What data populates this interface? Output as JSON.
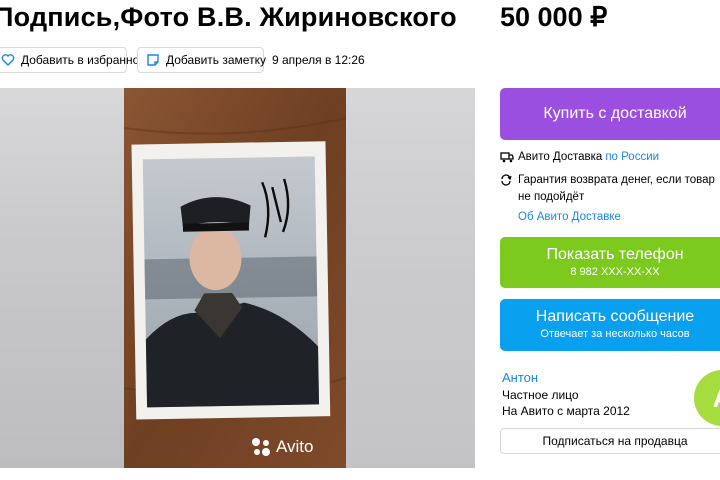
{
  "listing": {
    "title": "Подпись,Фото В.В. Жириновского",
    "price": "50 000 ₽",
    "favorite_label": "Добавить в избранное",
    "note_label": "Добавить заметку",
    "date": "9 апреля в 12:26"
  },
  "gallery": {
    "watermark": "Avito",
    "photo_alt": "Signed photograph on wooden table"
  },
  "purchase": {
    "buy_label": "Купить с доставкой",
    "delivery_prefix": "Авито Доставка",
    "delivery_link": "по России",
    "guarantee_text_1": "Гарантия возврата денег, если товар",
    "guarantee_text_2": "не подойдёт",
    "about_delivery_link": "Об Авито Доставке",
    "phone_label": "Показать телефон",
    "phone_number": "8 982 XXX-XX-XX",
    "message_label": "Написать сообщение",
    "message_sub": "Отвечает за несколько часов"
  },
  "seller": {
    "name": "Антон",
    "type": "Частное лицо",
    "since": "На Авито с марта 2012",
    "avatar_letter": "А",
    "subscribe_label": "Подписаться на продавца"
  },
  "colors": {
    "buy": "#9b4fe0",
    "phone": "#7dca1f",
    "message": "#0aa0f0",
    "link": "#1a88e8",
    "avatar": "#a6dd3e"
  },
  "icons": {
    "favorite": "heart-icon",
    "note": "note-icon",
    "delivery": "truck-icon",
    "guarantee": "refresh-icon",
    "watermark": "avito-logo-icon"
  }
}
